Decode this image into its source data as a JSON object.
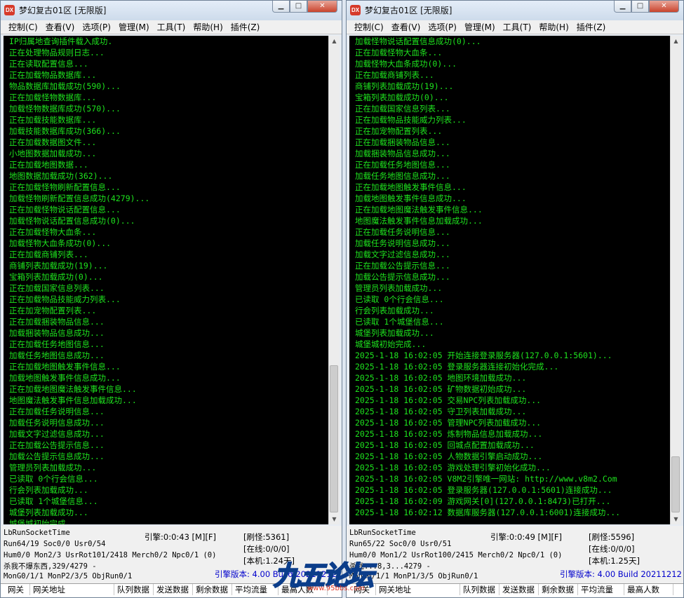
{
  "windows": [
    {
      "title": "梦幻复古01区 [无限版]",
      "app_icon_text": "DX",
      "menu": [
        "控制(C)",
        "查看(V)",
        "选项(P)",
        "管理(M)",
        "工具(T)",
        "帮助(H)",
        "插件(Z)"
      ],
      "log": [
        "IP归属地查询插件载入成功.",
        "正在处理物品规则日志...",
        "正在读取配置信息...",
        "正在加载物品数据库...",
        "物品数据库加载成功(590)...",
        "正在加载怪物数据库...",
        "加载怪物数据库成功(570)...",
        "正在加载技能数据库...",
        "加载技能数据库成功(366)...",
        "正在加载数据图文件...",
        "小地图数据加载成功...",
        "正在加载地图数据...",
        "地图数据加载成功(362)...",
        "正在加载怪物刷新配置信息...",
        "加载怪物刷新配置信息成功(4279)...",
        "正在加载怪物说话配置信息...",
        "加载怪物说话配置信息成功(0)...",
        "正在加载怪物大血条...",
        "加载怪物大血条成功(0)...",
        "正在加载商铺列表...",
        "商铺列表加载成功(19)...",
        "宝箱列表加载成功(0)...",
        "正在加载国家信息列表...",
        "正在加载物品技能威力列表...",
        "正在加宠物配置列表...",
        "正在加载捆装物品信息...",
        "加载捆装物品信息成功...",
        "正在加载任务地图信息...",
        "加载任务地图信息成功...",
        "正在加载地图触发事件信息...",
        "加载地图触发事件信息成功...",
        "正在加载地图魔法触发事件信息...",
        "地图魔法触发事件信息加载成功...",
        "正在加载任务说明信息...",
        "加载任务说明信息成功...",
        "加载文字过滤信息成功...",
        "正在加载公告提示信息...",
        "加载公告提示信息成功...",
        "管理员列表加载成功...",
        "已读取 0个行会信息...",
        "行会列表加载成功...",
        "已读取 1个城堡信息...",
        "城堡列表加载成功...",
        "城堡城初始完成..."
      ],
      "status": {
        "socket_label": "LbRunSocketTime",
        "engine_time": "引擎:0:0:43 [M][F]",
        "refresh": "[刷怪:5361]",
        "run_line": "Run64/19 Soc0/0 Usr0/54",
        "online": "[在线:0/0/0]",
        "hum_line": "Hum0/0 Mon2/3 UsrRot101/2418 Merch0/2 Npc0/1 (0)",
        "local_time": "[本机:1.24天]",
        "kill_line": "杀我不爆东西,329/4279 -",
        "mon_line": "MonG0/1/1 MonP2/3/5 ObjRun0/1",
        "version": "引擎版本: 4.00 Build 20211212"
      },
      "grid_headers": [
        "网关",
        "网关地址",
        "队列数据",
        "发送数据",
        "剩余数据",
        "平均流量",
        "最高人数"
      ]
    },
    {
      "title": "梦幻复古01区 [无限版]",
      "app_icon_text": "DX",
      "menu": [
        "控制(C)",
        "查看(V)",
        "选项(P)",
        "管理(M)",
        "工具(T)",
        "帮助(H)",
        "插件(Z)"
      ],
      "log": [
        "加载怪物说话配置信息成功(0)...",
        "正在加载怪物大血条...",
        "加载怪物大血条成功(0)...",
        "正在加载商铺列表...",
        "商铺列表加载成功(19)...",
        "宝箱列表加载成功(0)...",
        "正在加载国家信息列表...",
        "正在加载物品技能威力列表...",
        "正在加宠物配置列表...",
        "正在加载捆装物品信息...",
        "加载捆装物品信息成功...",
        "正在加载任务地图信息...",
        "加载任务地图信息成功...",
        "正在加载地图触发事件信息...",
        "加载地图触发事件信息成功...",
        "正在加载地图魔法触发事件信息...",
        "地图魔法触发事件信息加载成功...",
        "正在加载任务说明信息...",
        "加载任务说明信息成功...",
        "加载文字过滤信息成功...",
        "正在加载公告提示信息...",
        "加载公告提示信息成功...",
        "管理员列表加载成功...",
        "已读取 0个行会信息...",
        "行会列表加载成功...",
        "已读取 1个城堡信息...",
        "城堡列表加载成功...",
        "城堡城初始完成...",
        "2025-1-18 16:02:05 开始连接登录服务器(127.0.0.1:5601)...",
        "2025-1-18 16:02:05 登录服务器连接初始化完成...",
        "2025-1-18 16:02:05 地图环境加载成功...",
        "2025-1-18 16:02:05 矿物数据初始成功...",
        "2025-1-18 16:02:05 交易NPC列表加载成功...",
        "2025-1-18 16:02:05 守卫列表加载成功...",
        "2025-1-18 16:02:05 管理NPC列表加载成功...",
        "2025-1-18 16:02:05 炼制物品信息加载成功...",
        "2025-1-18 16:02:05 回城点配置加载成功...",
        "2025-1-18 16:02:05 人物数据引擎启动成功...",
        "2025-1-18 16:02:05 游戏处理引擎初始化成功...",
        "2025-1-18 16:02:05 V8M2引擎唯一网站: http://www.v8m2.Com",
        "2025-1-18 16:02:05 登录服务器(127.0.0.1:5601)连接成功...",
        "2025-1-18 16:02:09 游戏网关[0](127.0.0.1:8473)已打开...",
        "2025-1-18 16:02:12 数据库服务器(127.0.0.1:6001)连接成功..."
      ],
      "status": {
        "socket_label": "LbRunSocketTime",
        "engine_time": "引擎:0:0:49 [M][F]",
        "refresh": "[刷怪:5596]",
        "run_line": "Run65/22 Soc0/0 Usr0/51",
        "online": "[在线:0/0/0]",
        "hum_line": "Hum0/0 Mon1/2 UsrRot100/2415 Merch0/2 Npc0/1 (0)",
        "local_time": "[本机:1.25天]",
        "kill_line": "杀我...8,3...4279 -",
        "mon_line": "MonG0/1/1 MonP1/3/5 ObjRun0/1",
        "version": "引擎版本: 4.00 Build 20211212"
      },
      "grid_headers": [
        "网关",
        "网关地址",
        "队列数据",
        "发送数据",
        "剩余数据",
        "平均流量",
        "最高人数"
      ]
    }
  ],
  "watermark": {
    "text": "九五论坛",
    "url": "www.95bbs.com"
  },
  "window_buttons": {
    "minimize": "▁",
    "maximize": "□",
    "close": "✕"
  },
  "scroll_arrows": {
    "up": "▲",
    "down": "▼"
  }
}
